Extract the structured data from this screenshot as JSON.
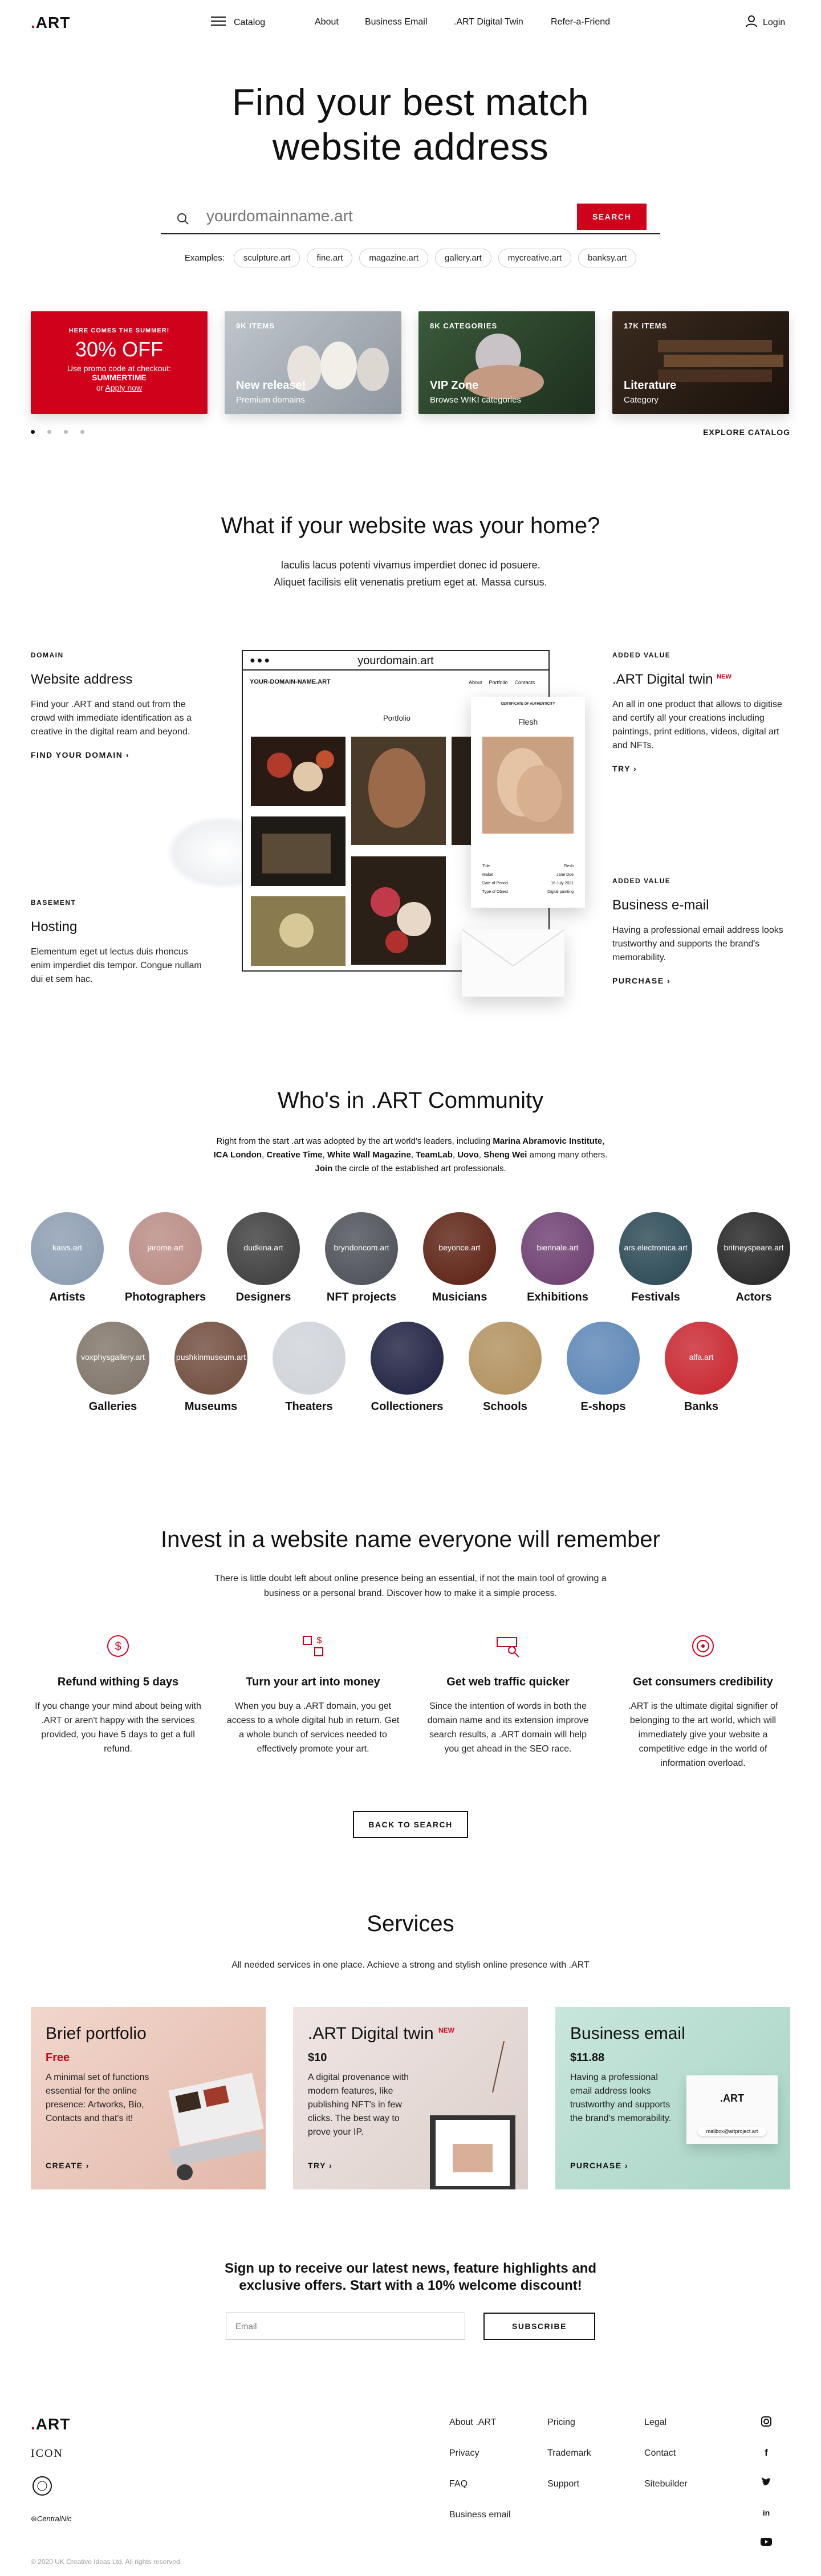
{
  "header": {
    "logo": ".ART",
    "catalog": "Catalog",
    "nav": [
      "About",
      "Business Email",
      ".ART Digital Twin",
      "Refer-a-Friend"
    ],
    "login": "Login"
  },
  "hero": {
    "title_line1": "Find your best match",
    "title_line2": "website address",
    "search_placeholder": "yourdomainname.art",
    "search_button": "SEARCH",
    "examples_label": "Examples:",
    "examples": [
      "sculpture.art",
      "fine.art",
      "magazine.art",
      "gallery.art",
      "mycreative.art",
      "banksy.art"
    ]
  },
  "promo_cards": [
    {
      "top": "HERE COMES THE SUMMER!",
      "big": "30% OFF",
      "line1": "Use promo code at checkout:",
      "code": "SUMMERTIME",
      "or": "or",
      "link": "Apply now"
    },
    {
      "cat": "9K ITEMS",
      "title": "New release!",
      "sub": "Premium domains"
    },
    {
      "cat": "8K CATEGORIES",
      "title": "VIP Zone",
      "sub": "Browse WIKI categories"
    },
    {
      "cat": "17K ITEMS",
      "title": "Literature",
      "sub": "Category"
    }
  ],
  "explore_catalog": "EXPLORE CATALOG",
  "home": {
    "title": "What if your website was your home?",
    "sub1": "Iaculis lacus potenti vivamus imperdiet donec id posuere.",
    "sub2": "Aliquet facilisis elit venenatis pretium eget at. Massa cursus.",
    "browser_url": "yourdomain.art",
    "site_name": "YOUR-DOMAIN-NAME.ART",
    "site_nav": [
      "About",
      "Portfolio",
      "Contacts"
    ],
    "portfolio": "Portfolio",
    "cert_title": "CERTIFICATE OF AUTHENTICITY",
    "cert_name": "Flesh",
    "cert_rows": [
      [
        "Title",
        "Flesh"
      ],
      [
        "Maker",
        "Jane Doe"
      ],
      [
        "Date of Period",
        "16 July 2021"
      ],
      [
        "Type of Object",
        "Digital painting"
      ]
    ],
    "features": [
      {
        "label": "DOMAIN",
        "title": "Website address",
        "body": "Find your .ART and stand out from the crowd with immediate identification as a creative in the digital ream and beyond.",
        "link": "FIND YOUR DOMAIN"
      },
      {
        "label": "ADDED VALUE",
        "title": ".ART Digital twin",
        "badge": "NEW",
        "body": "An all in one product that allows to digitise and certify all your creations including paintings, print editions, videos, digital art and NFTs.",
        "link": "TRY"
      },
      {
        "label": "BASEMENT",
        "title": "Hosting",
        "body": "Elementum eget ut lectus duis rhoncus enim imperdiet dis tempor. Congue nullam dui et sem hac.",
        "link": ""
      },
      {
        "label": "ADDED VALUE",
        "title": "Business e-mail",
        "body": "Having a professional email address looks trustworthy and supports the brand's memorability.",
        "link": "PURCHASE"
      }
    ]
  },
  "community": {
    "title": "Who's in .ART Community",
    "intro_a": "Right from the start .art was adopted by the art world's leaders, including ",
    "intro_b": "Marina Abramovic Institute",
    "intro_c": ", ",
    "intro_d": "ICA London",
    "intro_e": ", ",
    "intro_f": "Creative Time",
    "intro_g": ", ",
    "intro_h": "White Wall Magazine",
    "intro_i": ", ",
    "intro_j": "TeamLab",
    "intro_k": ", ",
    "intro_l": "Uovo",
    "intro_m": ", ",
    "intro_n": "Sheng Wei",
    "intro_o": " among many others. ",
    "intro_p": "Join",
    "intro_q": " the circle of the established art professionals.",
    "row1": [
      {
        "name": "Artists",
        "domain": "kaws.art",
        "color": "#8a9bb0"
      },
      {
        "name": "Photographers",
        "domain": "jarome.art",
        "color": "#b88a82"
      },
      {
        "name": "Designers",
        "domain": "dudkina.art",
        "color": "#3a3a3a"
      },
      {
        "name": "NFT projects",
        "domain": "bryndoncom.art",
        "color": "#4a4d55"
      },
      {
        "name": "Musicians",
        "domain": "beyonce.art",
        "color": "#5a1e10"
      },
      {
        "name": "Exhibitions",
        "domain": "biennale.art",
        "color": "#6b3b6e"
      },
      {
        "name": "Festivals",
        "domain": "ars.electronica.art",
        "color": "#274652"
      },
      {
        "name": "Actors",
        "domain": "britneyspeare.art",
        "color": "#222222"
      }
    ],
    "row2": [
      {
        "name": "Galleries",
        "domain": "voxphysgallery.art",
        "color": "#7e7266"
      },
      {
        "name": "Museums",
        "domain": "pushkinmuseum.art",
        "color": "#6e4a3a"
      },
      {
        "name": "Theaters",
        "domain": "",
        "color": "#cfd3d9"
      },
      {
        "name": "Collectioners",
        "domain": "",
        "color": "#1b1e3e"
      },
      {
        "name": "Schools",
        "domain": "",
        "color": "#b08f5c"
      },
      {
        "name": "E-shops",
        "domain": "",
        "color": "#5a85b5"
      },
      {
        "name": "Banks",
        "domain": "alfa.art",
        "color": "#c8232c"
      }
    ]
  },
  "invest": {
    "title": "Invest in a website name everyone will remember",
    "sub1": "There is little doubt left about online presence being an essential, if not the main tool of growing a",
    "sub2": "business or a personal brand. Discover how to make it a simple process.",
    "benefits": [
      {
        "title": "Refund withing 5 days",
        "body": "If you change your mind about being with .ART or aren't happy with the services provided, you have 5 days to get a full refund."
      },
      {
        "title": "Turn your art into money",
        "body": "When you buy a .ART domain, you get access to a whole digital hub in return. Get a whole bunch of services needed to effectively promote your art."
      },
      {
        "title": "Get web traffic quicker",
        "body": "Since the intention of words in both the domain name and its extension improve search results, a .ART domain will help you get ahead in the SEO race."
      },
      {
        "title": "Get consumers credibility",
        "body": ".ART is the ultimate digital signifier of belonging to the art world, which will immediately give your website a competitive edge in the world of information overload."
      }
    ],
    "back_button": "BACK TO SEARCH"
  },
  "services": {
    "title": "Services",
    "sub": "All needed services in one place. Achieve a strong and stylish online presence with .ART",
    "items": [
      {
        "title": "Brief portfolio",
        "price": "Free",
        "body": "A minimal set of functions essential for the online presence: Artworks, Bio, Contacts and that's it!",
        "link": "CREATE"
      },
      {
        "title": ".ART Digital twin",
        "badge": "NEW",
        "price": "$10",
        "body": "A digital provenance with modern features, like publishing NFT's in few clicks. The best way to prove your IP.",
        "link": "TRY"
      },
      {
        "title": "Business email",
        "price": "$11.88",
        "body": "Having a professional email address looks trustworthy and supports the brand's memorability.",
        "link": "PURCHASE",
        "mail_tag": "mailbox@artproject.art",
        "mail_logo": ".ART"
      }
    ]
  },
  "newsletter": {
    "line1": "Sign up to receive our latest news, feature highlights and",
    "line2": "exclusive offers. Start with a 10% welcome discount!",
    "placeholder": "Email",
    "button": "SUBSCRIBE"
  },
  "footer": {
    "logo": ".ART",
    "icon_logo": "ICON",
    "col1": [
      "About .ART",
      "Privacy",
      "FAQ",
      "Business email"
    ],
    "col2": [
      "Pricing",
      "Trademark",
      "Support"
    ],
    "col3": [
      "Legal",
      "Contact",
      "Sitebuilder"
    ],
    "social": [
      "instagram-icon",
      "facebook-icon",
      "twitter-icon",
      "linkedin-icon",
      "youtube-icon"
    ],
    "copyright": "© 2020 UK Creative Ideas Ltd. All rights reserved."
  },
  "colors": {
    "accent": "#d0021b",
    "text": "#111111"
  }
}
